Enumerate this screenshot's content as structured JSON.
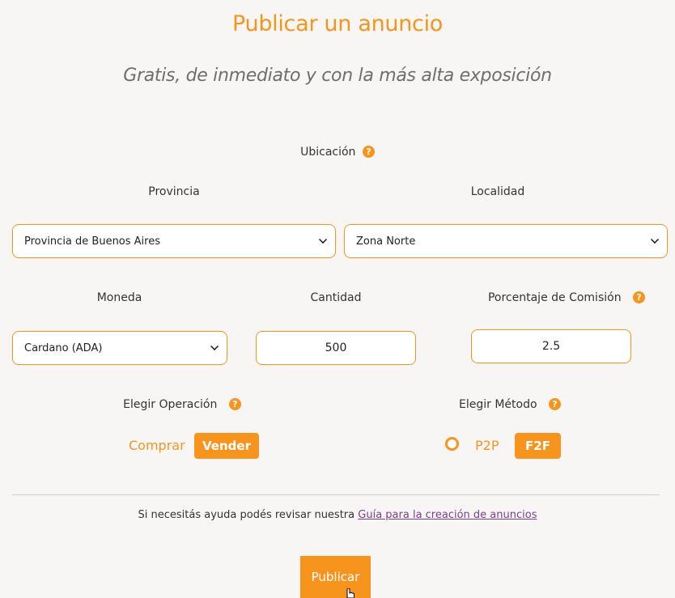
{
  "header": {
    "title": "Publicar un anuncio",
    "subtitle": "Gratis, de inmediato y con la más alta exposición"
  },
  "location": {
    "label": "Ubicación",
    "province": {
      "label": "Provincia",
      "value": "Provincia de Buenos Aires"
    },
    "locality": {
      "label": "Localidad",
      "value": "Zona Norte"
    }
  },
  "currency": {
    "label": "Moneda",
    "value": "Cardano (ADA)"
  },
  "amount": {
    "label": "Cantidad",
    "value": "500"
  },
  "commission": {
    "label": "Porcentaje de Comisión",
    "value": "2.5"
  },
  "operation": {
    "label": "Elegir Operación",
    "buy_label": "Comprar",
    "sell_label": "Vender",
    "selected": "Vender"
  },
  "method": {
    "label": "Elegir Método",
    "p2p_label": "P2P",
    "f2f_label": "F2F",
    "selected": "F2F"
  },
  "help": {
    "text": "Si necesitás ayuda podés revisar nuestra",
    "link_label": "Guía para la creación de anuncios"
  },
  "publish_label": "Publicar",
  "icons": {
    "help": "question-mark-icon",
    "dropdown": "chevron-down-icon",
    "cursor": "hand-pointer-icon"
  },
  "colors": {
    "accent": "#f7941d",
    "link": "#7b3f8c",
    "background": "#f7f6f4"
  }
}
